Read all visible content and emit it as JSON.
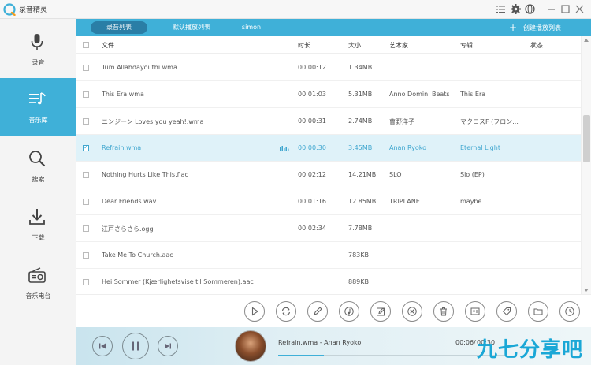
{
  "app": {
    "title": "录音精灵"
  },
  "sidebar": {
    "items": [
      {
        "label": "录音",
        "icon": "microphone-icon"
      },
      {
        "label": "音乐库",
        "icon": "music-library-icon",
        "active": true
      },
      {
        "label": "搜索",
        "icon": "search-icon"
      },
      {
        "label": "下载",
        "icon": "download-icon"
      },
      {
        "label": "音乐电台",
        "icon": "radio-icon"
      }
    ]
  },
  "tabs": {
    "items": [
      {
        "label": "录音列表",
        "active": true
      },
      {
        "label": "默认播放列表"
      },
      {
        "label": "simon"
      }
    ],
    "create_label": "创建播放列表",
    "create_icon": "+"
  },
  "table": {
    "headers": {
      "file": "文件",
      "time": "时长",
      "size": "大小",
      "artist": "艺术家",
      "album": "专辑",
      "status": "状态"
    },
    "rows": [
      {
        "file": "Tum Allahdayouthi.wma",
        "time": "00:00:12",
        "size": "1.34MB",
        "artist": "",
        "album": ""
      },
      {
        "file": "This Era.wma",
        "time": "00:01:03",
        "size": "5.31MB",
        "artist": "Anno Domini Beats",
        "album": "This Era"
      },
      {
        "file": "ニンジーン Loves you yeah!.wma",
        "time": "00:00:31",
        "size": "2.74MB",
        "artist": "曹野洋子",
        "album": "マクロスF (フロン..."
      },
      {
        "file": "Refrain.wma",
        "time": "00:00:30",
        "size": "3.45MB",
        "artist": "Anan Ryoko",
        "album": "Eternal Light",
        "selected": true
      },
      {
        "file": "Nothing Hurts Like This.flac",
        "time": "00:02:12",
        "size": "14.21MB",
        "artist": "SLO",
        "album": "Slo (EP)"
      },
      {
        "file": "Dear Friends.wav",
        "time": "00:01:16",
        "size": "12.85MB",
        "artist": "TRIPLANE",
        "album": "maybe"
      },
      {
        "file": "江戸さらさら.ogg",
        "time": "00:02:34",
        "size": "7.78MB",
        "artist": "",
        "album": ""
      },
      {
        "file": "Take Me To Church.aac",
        "time": "",
        "size": "783KB",
        "artist": "",
        "album": ""
      },
      {
        "file": "Hei Sommer (Kjærlighetsvise til Sommeren).aac",
        "time": "",
        "size": "889KB",
        "artist": "",
        "album": ""
      }
    ]
  },
  "toolbar": {
    "buttons": [
      "play-icon",
      "convert-icon",
      "edit-icon",
      "music-note-icon",
      "edit-tags-icon",
      "delete-icon",
      "trash-icon",
      "card-icon",
      "tag-icon",
      "folder-icon",
      "clock-icon"
    ]
  },
  "player": {
    "now_playing": "Refrain.wma - Anan Ryoko",
    "time_current": "00:06/",
    "time_total": "00:30",
    "progress": 0.2,
    "watermark": "九七分享吧"
  },
  "colors": {
    "accent": "#3fb0d8",
    "tab_active": "#2a7ea6",
    "selected_row": "#dff2f9"
  }
}
